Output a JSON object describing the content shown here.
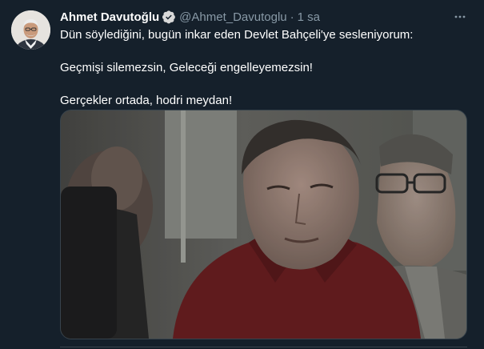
{
  "tweet": {
    "author_name": "Ahmet Davutoğlu",
    "handle": "@Ahmet_Davutoglu",
    "separator": "·",
    "time": "1 sa",
    "lines": [
      "Dün söylediğini, bugün inkar eden Devlet Bahçeli'ye sesleniyorum:",
      "Geçmişi silemezsin, Geleceği engelleyemezsin!",
      "Gerçekler ortada, hodri meydan!"
    ]
  },
  "icons": {
    "verified": "verified-badge-icon",
    "more": "more-horizontal-icon"
  },
  "colors": {
    "background": "#15202b",
    "text": "#ffffff",
    "secondary_text": "#8899a6",
    "border": "#38444d"
  }
}
